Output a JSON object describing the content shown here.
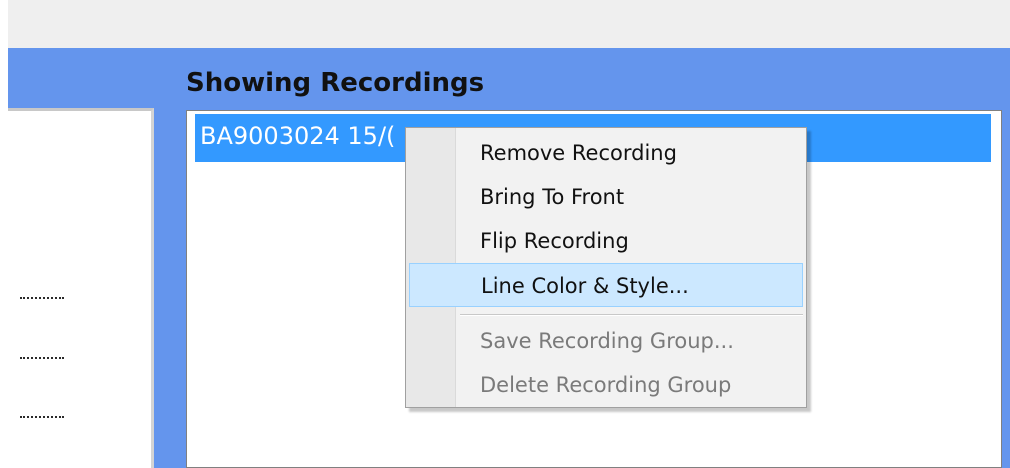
{
  "panel": {
    "title": "Showing Recordings",
    "selected_recording": "BA9003024 15/("
  },
  "context_menu": {
    "items": [
      {
        "label": "Remove Recording",
        "enabled": true,
        "highlighted": false
      },
      {
        "label": "Bring To Front",
        "enabled": true,
        "highlighted": false
      },
      {
        "label": "Flip Recording",
        "enabled": true,
        "highlighted": false
      },
      {
        "label": "Line Color & Style...",
        "enabled": true,
        "highlighted": true
      },
      {
        "label": "Save Recording Group...",
        "enabled": false,
        "highlighted": false
      },
      {
        "label": "Delete Recording Group",
        "enabled": false,
        "highlighted": false
      }
    ]
  },
  "colors": {
    "panel_background": "#6495ed",
    "selection": "#3399ff",
    "menu_highlight": "#cce8ff",
    "disabled_text": "#7a7a7a"
  }
}
